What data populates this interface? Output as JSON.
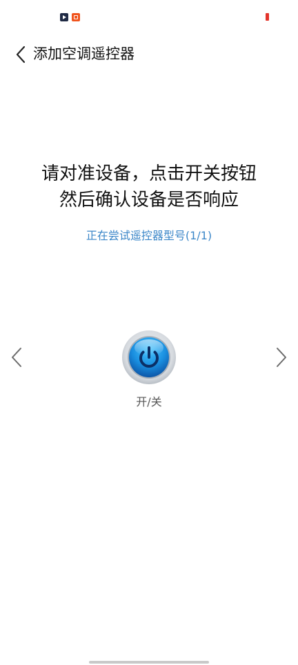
{
  "header": {
    "title": "添加空调遥控器"
  },
  "instructions": {
    "line1": "请对准设备，点击开关按钮",
    "line2": "然后确认设备是否响应"
  },
  "model_progress": "正在尝试遥控器型号(1/1)",
  "power_button": {
    "label": "开/关",
    "icon": "power-icon"
  },
  "navigation": {
    "prev_icon": "chevron-left-icon",
    "next_icon": "chevron-right-icon"
  },
  "colors": {
    "accent_text": "#3a86c8",
    "power_blue": "#1476c8",
    "battery_low": "#e3342b"
  }
}
